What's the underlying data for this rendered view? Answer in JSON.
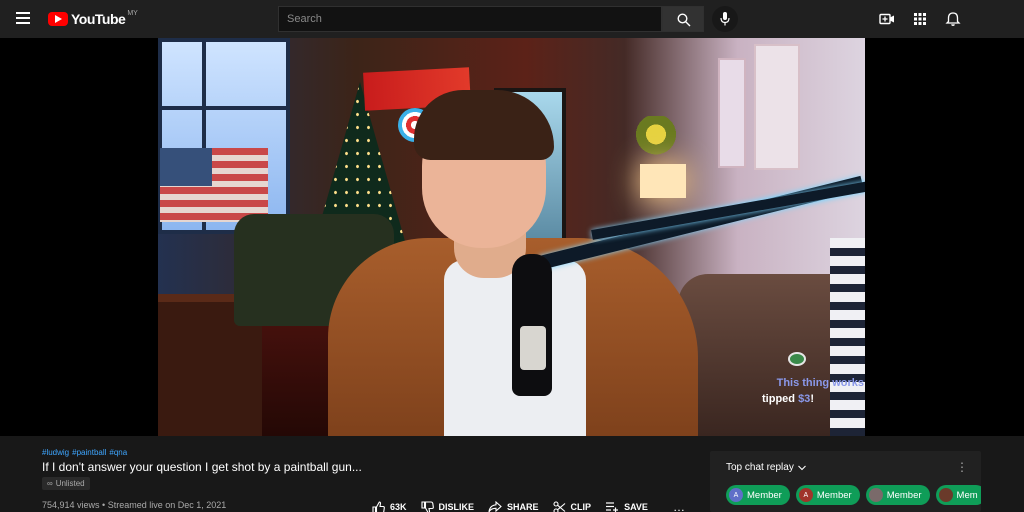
{
  "app": {
    "logo_text": "YouTube",
    "logo_region": "MY"
  },
  "search": {
    "placeholder": "Search",
    "value": ""
  },
  "video": {
    "overlay_message": "This thing works",
    "overlay_tip_prefix": "tipped ",
    "overlay_tip_amount": "$3",
    "overlay_tip_suffix": "!"
  },
  "meta": {
    "hashtags": [
      "#ludwig",
      "#paintball",
      "#qna"
    ],
    "title": "If I don't answer your question I get shot by a paintball gun...",
    "visibility_badge": "Unlisted",
    "stats": "754,914 views • Streamed live on Dec 1, 2021"
  },
  "actions": {
    "like_count": "63K",
    "dislike": "DISLIKE",
    "share": "SHARE",
    "clip": "CLIP",
    "save": "SAVE",
    "more": "…"
  },
  "chat": {
    "header": "Top chat replay",
    "kebab": "⋮",
    "chips": [
      {
        "avatar": "A",
        "avatar_color": "#5f6fc8",
        "label": "Member"
      },
      {
        "avatar": "A",
        "avatar_color": "#a0342a",
        "label": "Member"
      },
      {
        "avatar": "",
        "avatar_color": "#7a6a6a",
        "label": "Member"
      },
      {
        "avatar": "",
        "avatar_color": "#6a3a2a",
        "label": "Mem"
      }
    ]
  },
  "colors": {
    "brand_red": "#ff0000",
    "link_blue": "#3ea6ff",
    "chip_green": "#0f9d58",
    "overlay_purple": "#8a98ea"
  },
  "icons": {
    "menu": "menu-icon",
    "search": "search-icon",
    "mic": "mic-icon",
    "create": "create-video-icon",
    "apps": "apps-grid-icon",
    "notifications": "bell-icon"
  }
}
